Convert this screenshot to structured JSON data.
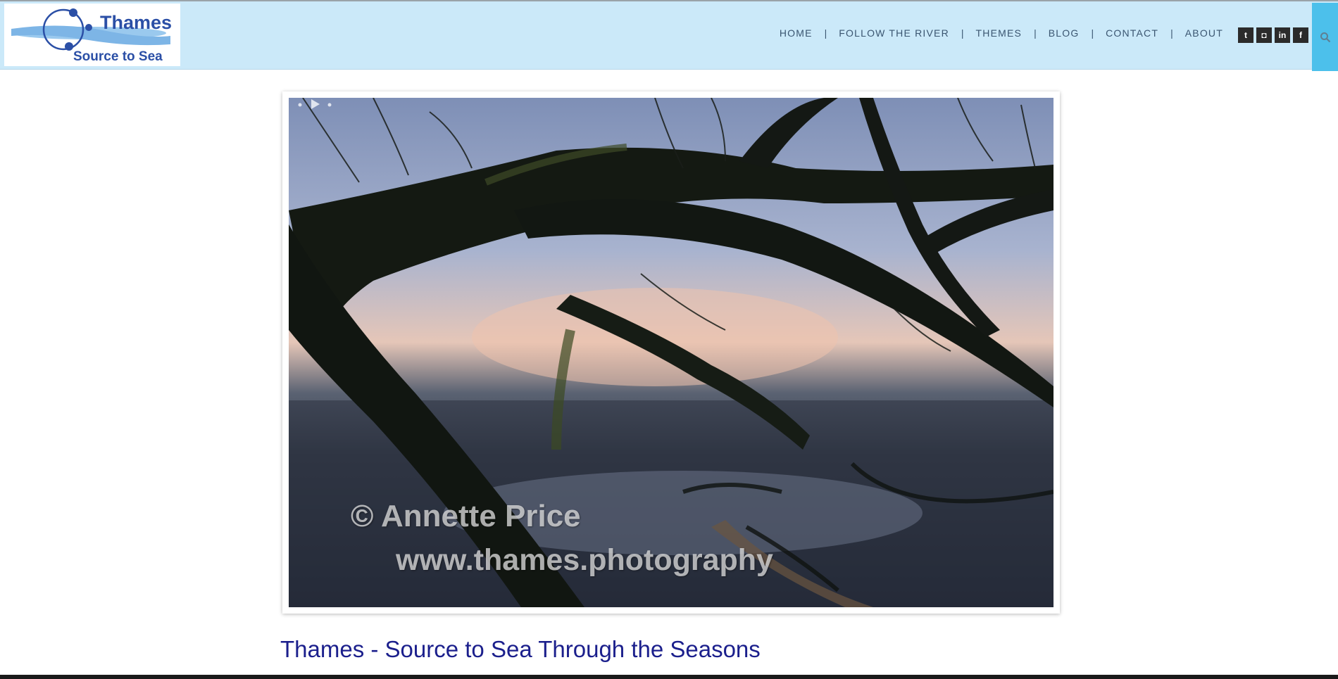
{
  "logo": {
    "title": "Thames",
    "subtitle": "Source to Sea"
  },
  "nav": {
    "items": [
      {
        "label": "HOME"
      },
      {
        "label": "FOLLOW THE RIVER"
      },
      {
        "label": "THEMES"
      },
      {
        "label": "BLOG"
      },
      {
        "label": "CONTACT"
      },
      {
        "label": "ABOUT"
      }
    ],
    "separator": "|"
  },
  "social": [
    {
      "icon": "twitter-icon",
      "glyph": "t"
    },
    {
      "icon": "instagram-icon",
      "glyph": "◘"
    },
    {
      "icon": "linkedin-icon",
      "glyph": "in"
    },
    {
      "icon": "facebook-icon",
      "glyph": "f"
    }
  ],
  "search": {
    "icon": "search-icon"
  },
  "hero": {
    "watermark_line1": "© Annette Price",
    "watermark_line2": "www.thames.photography"
  },
  "page_title": "Thames - Source to Sea Through the Seasons",
  "colors": {
    "header_bg": "#cbe9f9",
    "search_bg": "#4cc0eb",
    "title": "#1b1f8c",
    "logo": "#2b4fa6"
  }
}
